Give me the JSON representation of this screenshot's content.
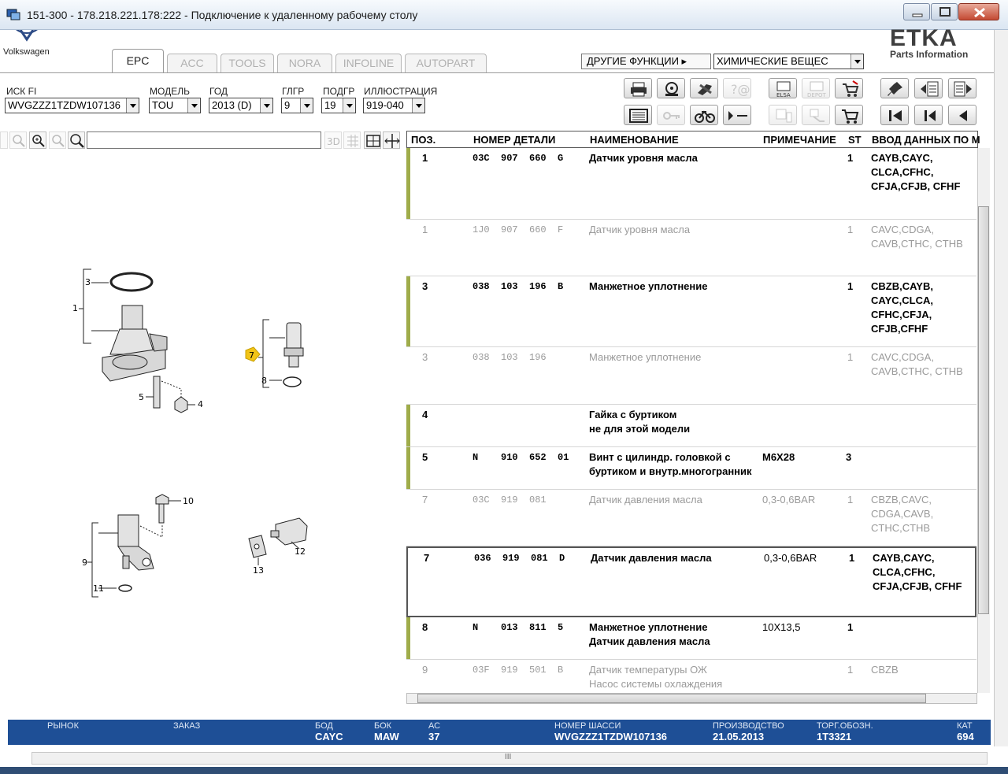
{
  "window": {
    "title": "151-300 - 178.218.221.178:222 - Подключение к удаленному рабочему столу"
  },
  "brand": {
    "vw": "Volkswagen",
    "etka": "ETKA",
    "etka_sub": "Parts Information"
  },
  "tabs": [
    "EPC",
    "ACC",
    "TOOLS",
    "NORA",
    "INFOLINE",
    "AUTOPART"
  ],
  "other_functions": {
    "label": "ДРУГИЕ ФУНКЦИИ ▸",
    "value": "ХИМИЧЕСКИЕ ВЕЩЕС"
  },
  "filters": {
    "vin": {
      "label": "ИСК FI",
      "value": "WVGZZZ1TZDW107136"
    },
    "model": {
      "label": "МОДЕЛЬ",
      "value": "TOU"
    },
    "year": {
      "label": "ГОД",
      "value": "2013 (D)"
    },
    "mgroup": {
      "label": "ГЛГР",
      "value": "9"
    },
    "subgroup": {
      "label": "ПОДГР",
      "value": "19"
    },
    "illustration": {
      "label": "ИЛЛЮСТРАЦИЯ",
      "value": "919-040"
    }
  },
  "toolbar_icons": {
    "elsa": "ELSA",
    "depot": "DEPOT",
    "btn_3d": "3D"
  },
  "table": {
    "headers": {
      "pos": "ПОЗ.",
      "partno": "НОМЕР ДЕТАЛИ",
      "name": "НАИМЕНОВАНИЕ",
      "note": "ПРИМЕЧАНИЕ",
      "st": "ST",
      "data": "ВВОД ДАННЫХ ПО М"
    },
    "rows": [
      {
        "pos": "1",
        "partno": "03C  907  660  G",
        "name": "Датчик уровня масла",
        "note": "",
        "st": "1",
        "data": "CAYB,CAYC, CLCA,CFHC, CFJA,CFJB, CFHF"
      },
      {
        "pos": "1",
        "partno": "1J0  907  660  F",
        "name": "Датчик уровня масла",
        "note": "",
        "st": "1",
        "data": "CAVC,CDGA, CAVB,CTHC, CTHB"
      },
      {
        "pos": "3",
        "partno": "038  103  196  B",
        "name": "Манжетное уплотнение",
        "note": "",
        "st": "1",
        "data": "CBZB,CAYB, CAYC,CLCA, CFHC,CFJA, CFJB,CFHF"
      },
      {
        "pos": "3",
        "partno": "038  103  196",
        "name": "Манжетное уплотнение",
        "note": "",
        "st": "1",
        "data": "CAVC,CDGA, CAVB,CTHC, CTHB"
      },
      {
        "pos": "4",
        "partno": "",
        "name": "Гайка с буртиком\nне для этой модели",
        "note": "",
        "st": "",
        "data": ""
      },
      {
        "pos": "5",
        "partno": "N    910  652  01",
        "name": "Винт с цилиндр. головкой с буртиком и внутр.многогранник",
        "note": "M6X28",
        "st": "3",
        "data": ""
      },
      {
        "pos": "7",
        "partno": "03C  919  081",
        "name": "Датчик давления масла",
        "note": "0,3-0,6BAR",
        "st": "1",
        "data": "CBZB,CAVC, CDGA,CAVB, CTHC,CTHB"
      },
      {
        "pos": "7",
        "partno": "036  919  081  D",
        "name": "Датчик давления масла",
        "note": "0,3-0,6BAR",
        "st": "1",
        "data": "CAYB,CAYC, CLCA,CFHC, CFJA,CFJB, CFHF"
      },
      {
        "pos": "8",
        "partno": "N    013  811  5",
        "name": "Манжетное уплотнение\nДатчик давления масла",
        "note": "10X13,5",
        "st": "1",
        "data": ""
      },
      {
        "pos": "9",
        "partno": "03F  919  501  B",
        "name": "Датчик температуры ОЖ\nНасос системы охлаждения",
        "note": "",
        "st": "1",
        "data": "CBZB"
      }
    ]
  },
  "illustration_labels": [
    "1",
    "3",
    "4",
    "5",
    "7",
    "8",
    "9",
    "10",
    "11",
    "12",
    "13"
  ],
  "status": {
    "market": {
      "label": "РЫНОК",
      "value": ""
    },
    "order": {
      "label": "ЗАКАЗ",
      "value": ""
    },
    "bod": {
      "label": "БОД",
      "value": "CAYC"
    },
    "bok": {
      "label": "БОК",
      "value": "MAW"
    },
    "ac": {
      "label": "АС",
      "value": "37"
    },
    "chassis": {
      "label": "НОМЕР ШАССИ",
      "value": "WVGZZZ1TZDW107136"
    },
    "production": {
      "label": "ПРОИЗВОДСТВО",
      "value": "21.05.2013"
    },
    "trade": {
      "label": "ТОРГ.ОБОЗН.",
      "value": "1T3321"
    },
    "cat": {
      "label": "КАТ",
      "value": "694"
    }
  },
  "scroll_grip": "III",
  "colors": {
    "status_bg": "#1e4f96",
    "row_marker": "#9fac4a",
    "callout": "#f2c418"
  }
}
